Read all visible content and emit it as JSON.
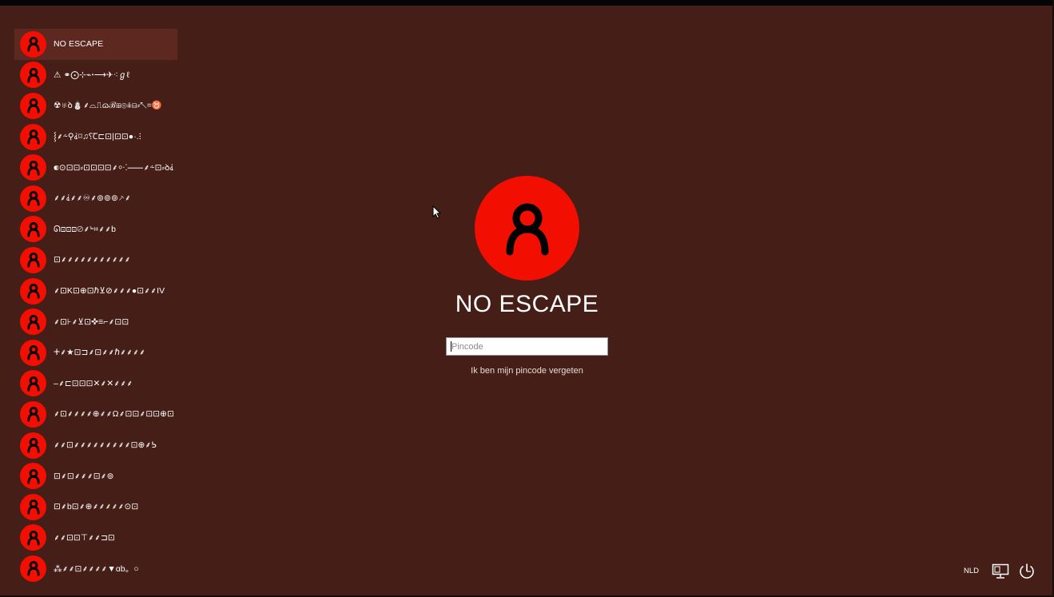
{
  "users": [
    {
      "name": "NO ESCAPE",
      "selected": true
    },
    {
      "name": "⚠͏͏ ⚭⨀⊹⌁ꞏ⟶✈︎⁖ℊℓ"
    },
    {
      "name": "☢♅ꝺ⛄⸙⌓⎍ɷℬ⊞⊚⋕⊟⸗↖=♉"
    },
    {
      "name": "⸾⸙⸞⚲⸘⌑♫⸮Ꞇ⊏⊡|⊡⊡●·.⁝"
    },
    {
      "name": "⁌⊙⊡⊡⸗⊡⊡⊡⊡⸙⸰⁖⸺⸙⸞⊡⸗ꝺ⸘⁂"
    },
    {
      "name": "⸙⸙⸘⸙⸙♾⸙⊚⊚⊚⸕⸙"
    },
    {
      "name": "ᘏ⊡⊡⊡⊘⸙ꚜ⌗⸙⸙b"
    },
    {
      "name": "⊡⸙⸙⸙⸙⸙⸙⸙⸙⸙⸙⸙"
    },
    {
      "name": "⸙⊡K⊡⊕⊡ℏ⊻⊘⸙⸙⸙●⊡⸙⸙IV"
    },
    {
      "name": "⸙⊡⊦⸙⊻⊡✜≡⌐⸙⊡⊡"
    },
    {
      "name": "ⵜ⸙★⊡⊐⸙⊡⸙⸙ℏ⸙⸙⸙⸙"
    },
    {
      "name": "–⸙⊏⊡⊡⊡✕⸙✕⸙⸙⸙"
    },
    {
      "name": "⸙⊡⸙⸙⸙⸙⊕⸙⸙Ω⸙⊡⊡⸙⊡⊡⊕⊡"
    },
    {
      "name": "⸙⸙⊡⸙⸙⸙⸙⸙⸙⸙⸙⸙⊡⊕⸙ᕊ"
    },
    {
      "name": "⊡⸙⊡⸙⸙⸙⊡⸙⊚"
    },
    {
      "name": "⊡⸙b⊡⸙⊕⸙⸙⸙⸙⸙⊙⊡"
    },
    {
      "name": "⸙⸙⊡⊡⊤⸙⸙⊐⊡"
    },
    {
      "name": "⁂⸙⸙⊡⸙⸙⸙⸙▼ɑb。○"
    }
  ],
  "main": {
    "username": "NO ESCAPE",
    "pin_placeholder": "Pincode",
    "forgot_link": "Ik ben mijn pincode vergeten"
  },
  "tray": {
    "language": "NLD",
    "network_icon": "network-monitor-icon",
    "power_icon": "power-icon"
  },
  "colors": {
    "background": "#451e17",
    "accent": "#f20e00",
    "selected_row": "#5c2820"
  }
}
